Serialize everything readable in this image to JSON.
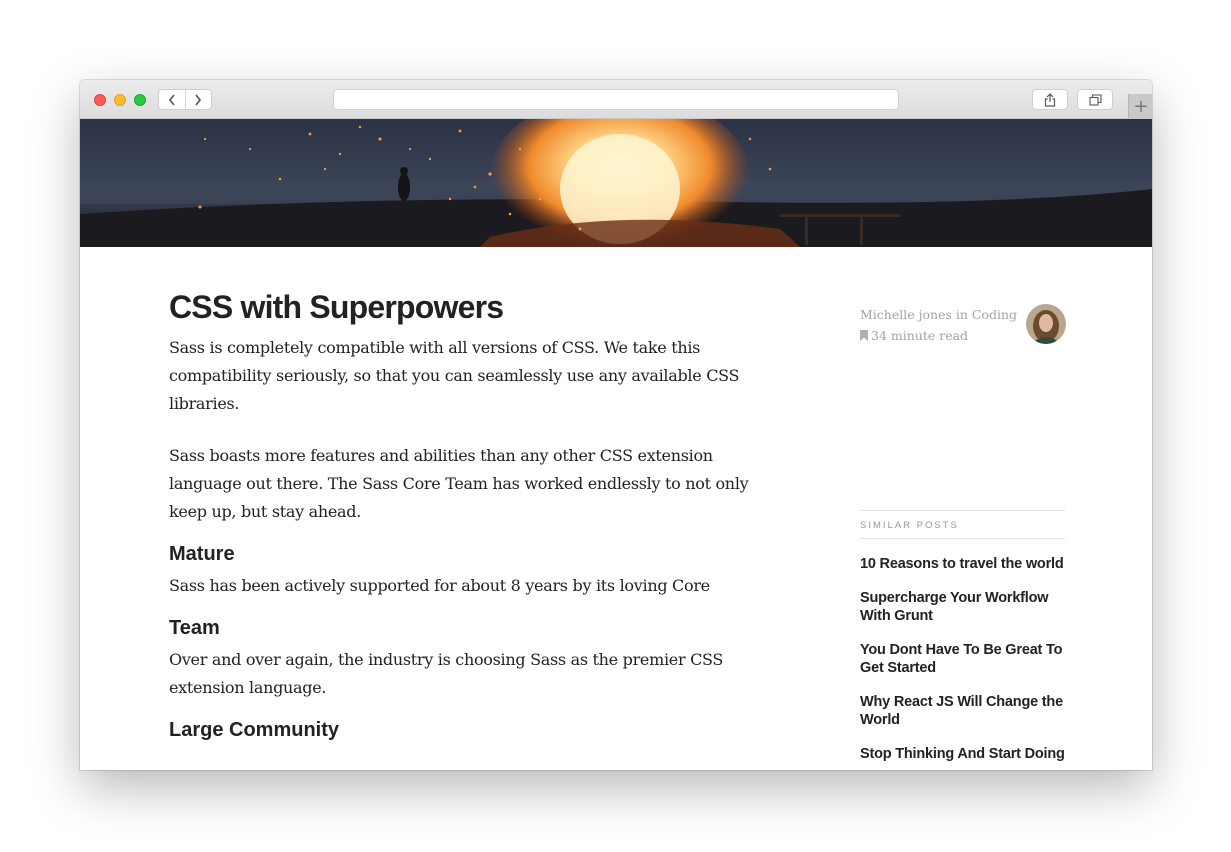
{
  "browser": {
    "back_icon": "chevron-left-icon",
    "forward_icon": "chevron-right-icon",
    "share_icon": "share-icon",
    "tabs_icon": "tabs-overview-icon",
    "new_tab_label": "+"
  },
  "article": {
    "title": "CSS with Superpowers",
    "intro_1": "Sass is completely compatible with all versions of CSS. We take this compatibility seriously, so that you can seamlessly use any available CSS libraries.",
    "intro_2": "Sass boasts more features and abilities than any other CSS extension language out there. The Sass Core Team has worked endlessly to not only keep up, but stay ahead.",
    "sections": [
      {
        "heading": "Mature",
        "text": "Sass has been actively supported for about 8 years by its loving Core"
      },
      {
        "heading": "Team",
        "text": "Over and over again, the industry is choosing Sass as the premier CSS extension language."
      },
      {
        "heading": "Large Community",
        "text": ""
      }
    ]
  },
  "meta": {
    "author": "Michelle jones",
    "joiner": "in",
    "category": "Coding",
    "read_time": "34 minute read",
    "read_icon": "bookmark-icon"
  },
  "similar": {
    "heading": "SIMILAR POSTS",
    "posts": [
      "10 Reasons to travel the world",
      "Supercharge Your Workflow With Grunt",
      "You Dont Have To Be Great To Get Started",
      "Why React JS Will Change the World",
      "Stop Thinking And Start Doing"
    ]
  }
}
